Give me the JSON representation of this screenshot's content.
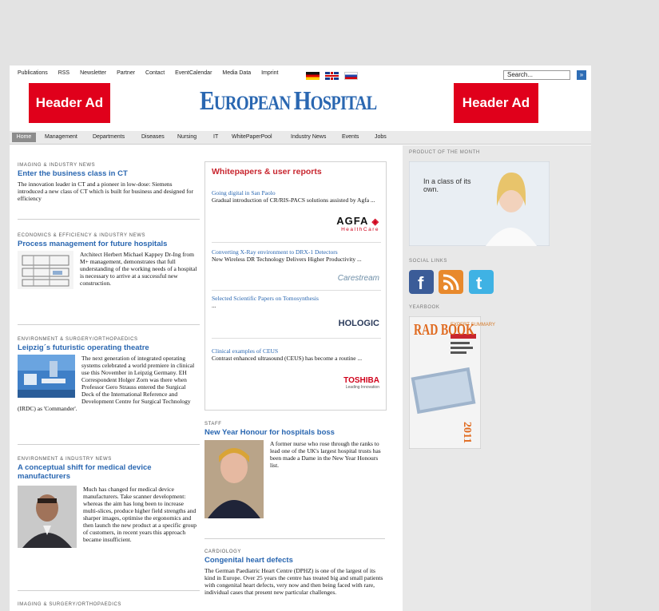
{
  "topbar": {
    "links": [
      "Publications",
      "RSS",
      "Newsletter",
      "Partner",
      "Contact",
      "EventCalendar",
      "Media Data",
      "Imprint"
    ],
    "search_placeholder": "Search...",
    "search_button_glyph": "»"
  },
  "header": {
    "ad_left": "Header Ad",
    "ad_right": "Header Ad",
    "logo_part1": "E",
    "logo_part2": "UROPEAN ",
    "logo_part3": "H",
    "logo_part4": "OSPITAL"
  },
  "nav": {
    "home": "Home",
    "items": [
      "Management",
      "Departments",
      "Diseases",
      "Nursing",
      "IT",
      "WhitePaperPool",
      "Industry News",
      "Events",
      "Jobs"
    ]
  },
  "left": {
    "a1": {
      "category": "IMAGING & INDUSTRY NEWS",
      "title": "Enter the business class in CT",
      "text": "The innovation leader in CT and a pioneer in low-dose: Siemens introduced a new class of CT which is built for business and designed for efficiency"
    },
    "a2": {
      "category": "ECONOMICS & EFFICIENCY & INDUSTRY NEWS",
      "title": "Process management for future hospitals",
      "text": "Architect Herbert Michael Kappey Dr-Ing from M+ management, demonstrates that full understanding of the working needs of a hospital is necessary to arrive at a successful new construction."
    },
    "a3": {
      "category": "ENVIRONMENT & SURGERY/ORTHOPAEDICS",
      "title": "Leipzig´s futuristic operating theatre",
      "text": "The next generation of integrated operating systems celebrated a world premiere in clinical use this November in Leipzig Germany. EH Correspondent Holger Zorn was there when Professor Gero Strauss entered the Surgical Deck of the International Reference and Development Centre for Surgical Technology (IRDC) as 'Commander'."
    },
    "a4": {
      "category": "ENVIRONMENT & INDUSTRY NEWS",
      "title": "A conceptual shift for medical device manufacturers",
      "text": "Much has changed for medical device manufacturers. Take scanner development: whereas the aim has long been to increase multi-slices, produce higher field strengths and sharper images, optimise the ergonomics and then launch the new product at a specific group of customers, in recent years this approach became insufficient."
    },
    "a5": {
      "category": "IMAGING & SURGERY/ORTHOPAEDICS"
    }
  },
  "whitepapers": {
    "heading": "Whitepapers & user reports",
    "items": [
      {
        "title": "Going digital in San Paolo",
        "desc": "Gradual introduction of CR/RIS-PACS solutions assisted by Agfa ...",
        "logo": "AGFA",
        "logo_sub": "HealthCare"
      },
      {
        "title": "Converting X-Ray environment to DRX-1 Detectors",
        "desc": "New Wireless DR Technology Delivers Higher Productivity ...",
        "logo": "Carestream",
        "logo_sub": ""
      },
      {
        "title": "Selected Scientific Papers on Tomosynthesis",
        "desc": "...",
        "logo": "HOLOGIC",
        "logo_sub": ""
      },
      {
        "title": "Clinical examples of CEUS",
        "desc": "Contrast enhanced ultrasound (CEUS) has become a routine ...",
        "logo": "TOSHIBA",
        "logo_sub": "Leading Innovation"
      }
    ]
  },
  "middle": {
    "a1": {
      "category": "STAFF",
      "title": "New Year Honour for hospitals boss",
      "text": "A former nurse who rose through the ranks to lead one of the UK's largest hospital trusts has been made a Dame in the New Year Honours list."
    },
    "a2": {
      "category": "CARDIOLOGY",
      "title": "Congenital heart defects",
      "text": "The German Paediatric Heart Centre (DPHZ) is one of the largest of its kind in Europe. Over 25 years the centre has treated big and small patients with congenital heart defects, very now and then being faced with rare, individual cases that present new particular challenges."
    }
  },
  "right": {
    "product_label": "PRODUCT OF THE MONTH",
    "product_text": "In a class of its own.",
    "social_label": "SOCIAL LINKS",
    "yearbook_label": "YEARBOOK",
    "yearbook_title": "RAD BOOK",
    "yearbook_year": "2011",
    "yearbook_subtitle": "EXPERT SUMMARY"
  },
  "colors": {
    "brand_blue": "#2a67b1",
    "ad_red": "#e0001b",
    "wp_red": "#c8262f"
  }
}
